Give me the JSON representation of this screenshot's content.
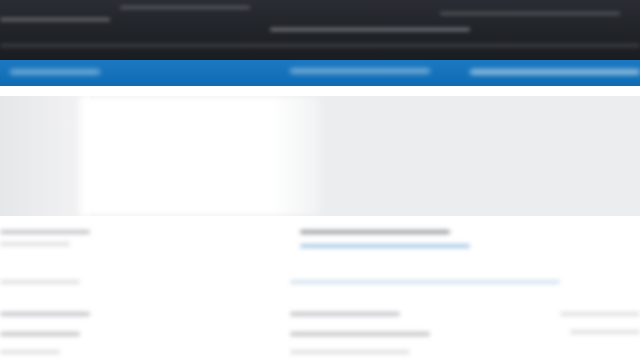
{
  "theme": {
    "topbar_color": "#1f2227",
    "nav_color": "#0f6bb3",
    "hero_color": "#ecedef",
    "background": "#ffffff"
  }
}
